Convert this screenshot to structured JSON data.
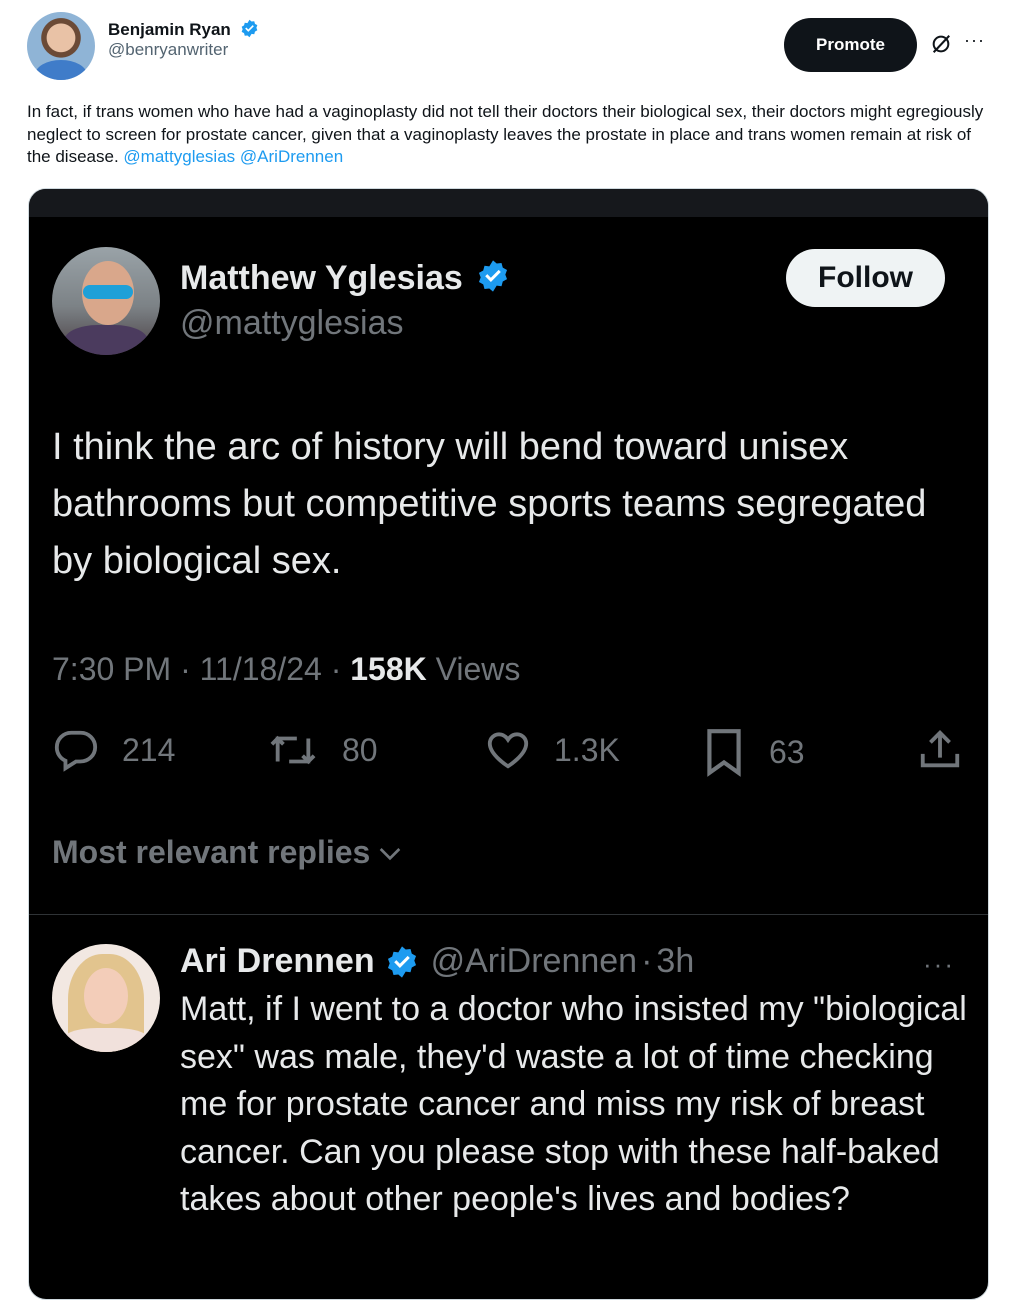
{
  "outer_tweet": {
    "author_name": "Benjamin Ryan",
    "author_handle": "@benryanwriter",
    "promote_label": "Promote",
    "more_label": "···",
    "text": "In fact, if trans women who have had a vaginoplasty did not tell their doctors their biological sex, their doctors might egregiously neglect to screen for prostate cancer, given that a vaginoplasty leaves the prostate in place and trans women remain at risk of the disease.",
    "mentions": [
      "@mattyglesias",
      "@AriDrennen"
    ],
    "verified_color": "#1d9bf0",
    "icons": {
      "verified": "verified-badge-icon",
      "grok": "grok-icon",
      "more": "more-icon"
    }
  },
  "embedded_tweet": {
    "author_name": "Matthew Yglesias",
    "author_handle": "@mattyglesias",
    "follow_label": "Follow",
    "text": "I think the arc of history will bend toward unisex bathrooms but competitive sports teams segregated by biological sex.",
    "time": "7:30 PM",
    "date": "11/18/24",
    "views_count": "158K",
    "views_label": "Views",
    "separator": "·",
    "actions": {
      "replies": "214",
      "reposts": "80",
      "likes": "1.3K",
      "bookmarks": "63"
    },
    "sort_label": "Most relevant replies",
    "icons": {
      "reply": "reply-icon",
      "repost": "repost-icon",
      "like": "heart-icon",
      "bookmark": "bookmark-icon",
      "share": "share-icon",
      "chevron": "chevron-down-icon"
    }
  },
  "reply": {
    "author_name": "Ari Drennen",
    "author_handle": "@AriDrennen",
    "age": "3h",
    "more_label": "···",
    "text": "Matt, if I went to a doctor who insisted my \"biological sex\" was male, they'd waste a lot of time checking me for prostate cancer and miss my risk of breast cancer. Can you please stop with these half-baked takes about other people's lives and bodies?"
  }
}
